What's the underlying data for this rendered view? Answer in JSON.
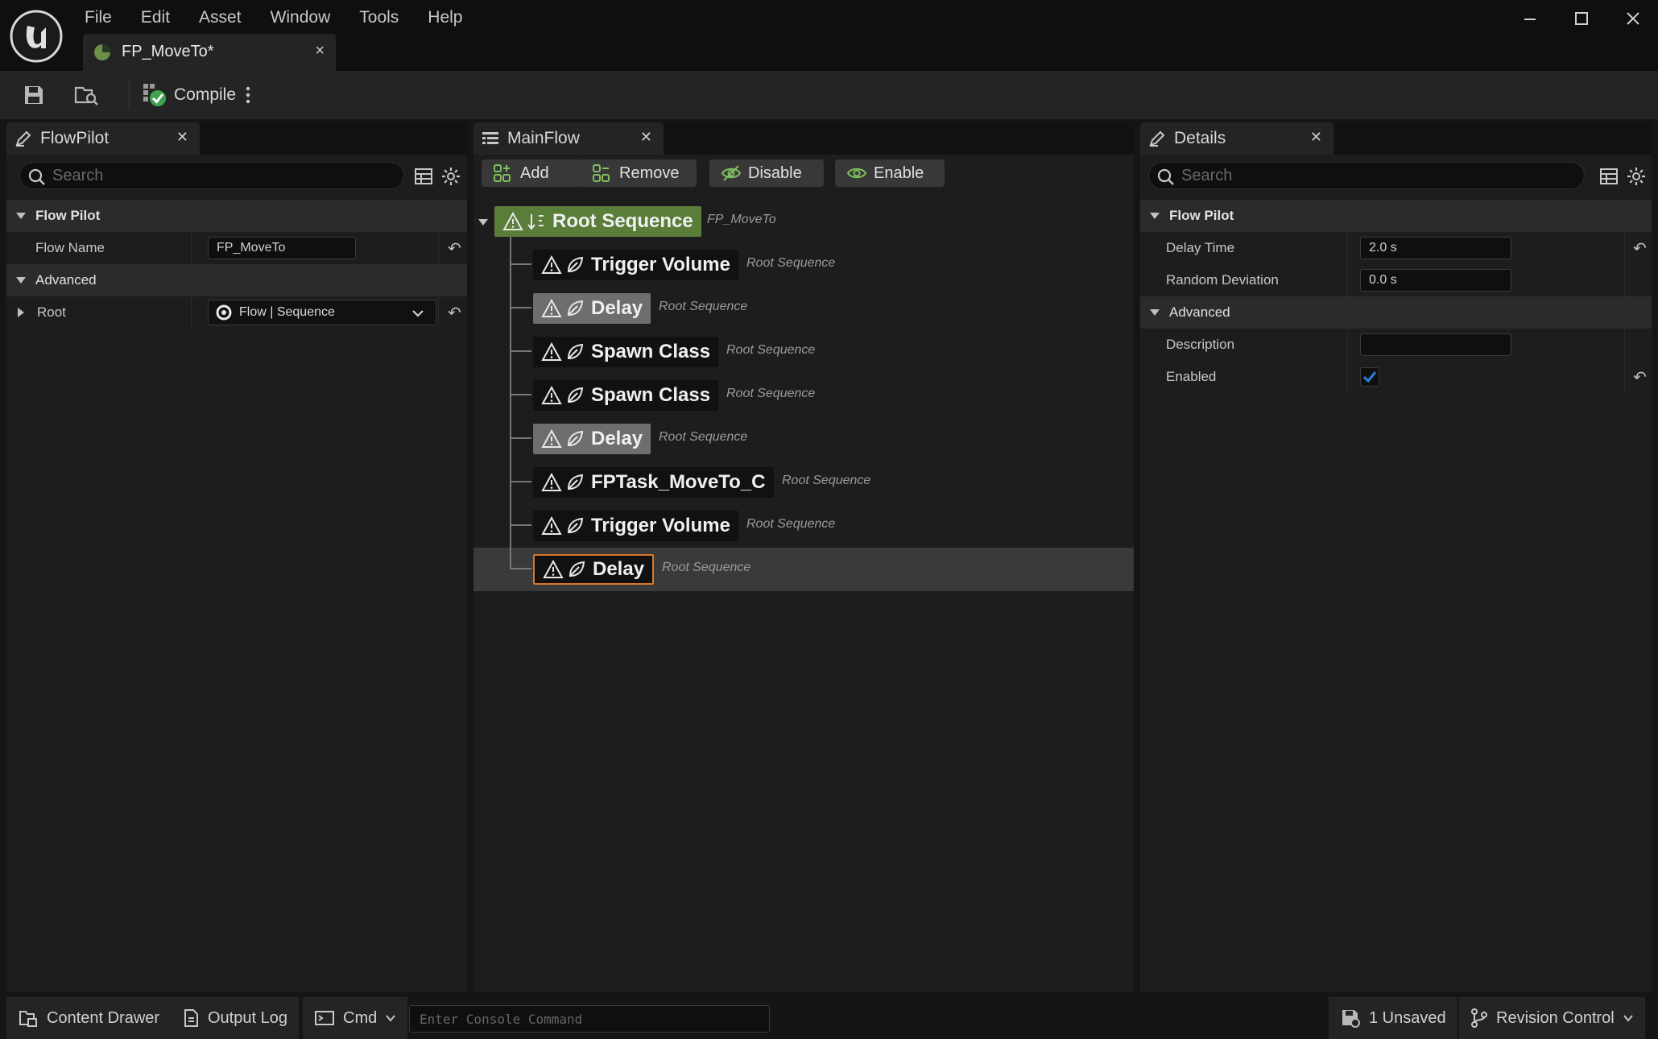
{
  "menu": [
    "File",
    "Edit",
    "Asset",
    "Window",
    "Tools",
    "Help"
  ],
  "document_tab": {
    "title": "FP_MoveTo*",
    "close": "×"
  },
  "toolbar": {
    "compile_label": "Compile"
  },
  "flowpilot_panel": {
    "tab_title": "FlowPilot",
    "search_placeholder": "Search",
    "sections": {
      "flow_pilot": "Flow Pilot",
      "advanced": "Advanced"
    },
    "flow_name_label": "Flow Name",
    "flow_name_value": "FP_MoveTo",
    "root_label": "Root",
    "root_value": "Flow | Sequence"
  },
  "mainflow_panel": {
    "tab_title": "MainFlow",
    "buttons": {
      "add": "Add",
      "remove": "Remove",
      "disable": "Disable",
      "enable": "Enable"
    },
    "root": {
      "label": "Root Sequence",
      "sub": "FP_MoveTo"
    },
    "children": [
      {
        "label": "Trigger Volume",
        "sub": "Root Sequence",
        "state": "normal"
      },
      {
        "label": "Delay",
        "sub": "Root Sequence",
        "state": "disabled"
      },
      {
        "label": "Spawn Class",
        "sub": "Root Sequence",
        "state": "normal"
      },
      {
        "label": "Spawn Class",
        "sub": "Root Sequence",
        "state": "normal"
      },
      {
        "label": "Delay",
        "sub": "Root Sequence",
        "state": "disabled"
      },
      {
        "label": "FPTask_MoveTo_C",
        "sub": "Root Sequence",
        "state": "normal"
      },
      {
        "label": "Trigger Volume",
        "sub": "Root Sequence",
        "state": "normal"
      },
      {
        "label": "Delay",
        "sub": "Root Sequence",
        "state": "selected"
      }
    ]
  },
  "details_panel": {
    "tab_title": "Details",
    "search_placeholder": "Search",
    "sections": {
      "flow_pilot": "Flow Pilot",
      "advanced": "Advanced"
    },
    "delay_time_label": "Delay Time",
    "delay_time_value": "2.0 s",
    "random_deviation_label": "Random Deviation",
    "random_deviation_value": "0.0 s",
    "description_label": "Description",
    "description_value": "",
    "enabled_label": "Enabled",
    "enabled_value": true
  },
  "statusbar": {
    "content_drawer": "Content Drawer",
    "output_log": "Output Log",
    "cmd": "Cmd",
    "console_placeholder": "Enter Console Command",
    "unsaved": "1 Unsaved",
    "revision_control": "Revision Control"
  },
  "colors": {
    "accent_selected": "#d9782a",
    "root_node_green": "#5b7d3a",
    "check_blue": "#2b7de0"
  }
}
